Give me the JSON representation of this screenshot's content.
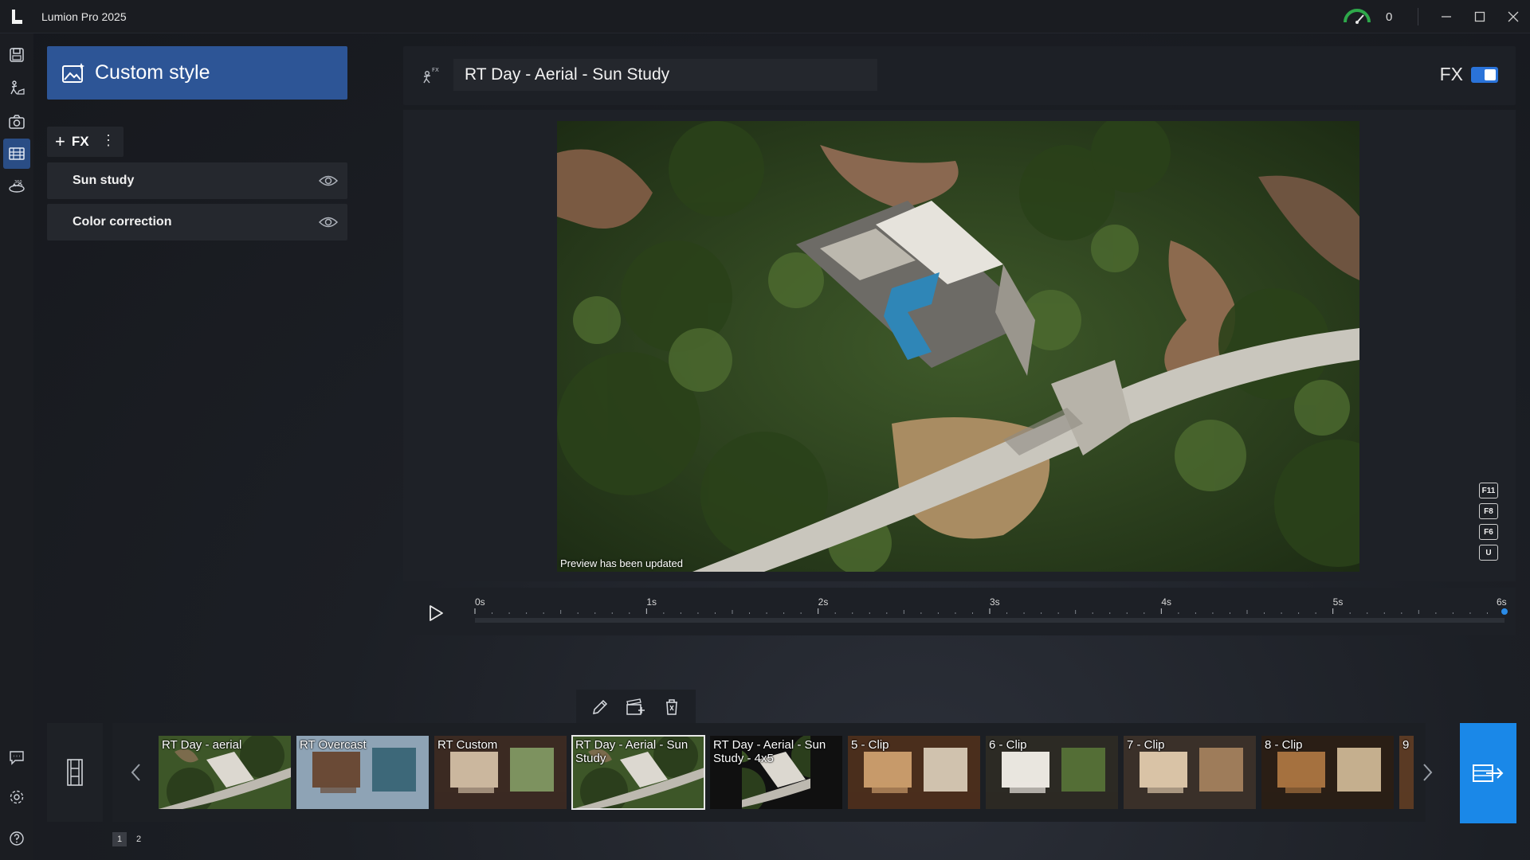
{
  "app": {
    "title": "Lumion Pro 2025",
    "performance_value": "0"
  },
  "left_rail": {
    "top_icons": [
      "file-icon",
      "build-icon",
      "photo-icon",
      "movie-icon",
      "panorama-icon"
    ],
    "active": "movie-icon",
    "bottom_icons": [
      "feedback-icon",
      "settings-icon",
      "help-icon"
    ]
  },
  "style_panel": {
    "style_button_label": "Custom style",
    "add_fx_label": "FX",
    "effects": [
      {
        "label": "Sun study",
        "visible": true
      },
      {
        "label": "Color correction",
        "visible": true
      }
    ]
  },
  "header": {
    "clip_name": "RT Day - Aerial - Sun Study",
    "fx_label": "FX",
    "fx_enabled": true
  },
  "preview": {
    "status": "Preview has been updated",
    "hotkeys": [
      "F11",
      "F8",
      "F6",
      "U"
    ]
  },
  "timeline": {
    "ticks": [
      "0s",
      "1s",
      "2s",
      "3s",
      "4s",
      "5s",
      "6s"
    ],
    "duration_s": 6,
    "playhead_s": 6
  },
  "filmstrip": {
    "clips": [
      {
        "label": "RT Day - aerial",
        "scene": "aerial",
        "selected": false
      },
      {
        "label": "RT Overcast",
        "scene": "exterior",
        "selected": false
      },
      {
        "label": "RT Custom",
        "scene": "interior",
        "selected": false
      },
      {
        "label": "RT Day - Aerial - Sun Study",
        "scene": "aerial",
        "selected": true
      },
      {
        "label": "RT Day - Aerial - Sun Study - 4x5",
        "scene": "aerial-portrait",
        "selected": false
      },
      {
        "label": "5 - Clip",
        "scene": "interior-wood",
        "selected": false
      },
      {
        "label": "6 - Clip",
        "scene": "interior-plants",
        "selected": false
      },
      {
        "label": "7 - Clip",
        "scene": "kitchen",
        "selected": false
      },
      {
        "label": "8 - Clip",
        "scene": "interior-dark",
        "selected": false
      },
      {
        "label": "9",
        "scene": "partial",
        "selected": false
      }
    ]
  },
  "pagination": {
    "pages": [
      "1",
      "2"
    ],
    "current": "1"
  },
  "colors": {
    "accent": "#2d5596",
    "render_button": "#1a88e8",
    "toggle": "#2a73d9"
  }
}
